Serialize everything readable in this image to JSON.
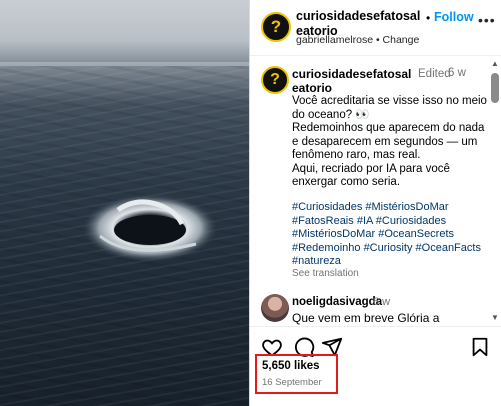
{
  "header": {
    "username": "curiosidadesefatosaleatorio",
    "separator": "•",
    "follow_label": "Follow",
    "audio": "gabriellamelrose • Change",
    "more_icon": "more-horizontal-icon"
  },
  "caption": {
    "username": "curiosidadesefatosaleatorio",
    "edited": "Edited",
    "time": "6 w",
    "lines": [
      "Você acreditaria se visse isso no meio do oceano? 👀",
      "Redemoinhos que aparecem do nada e desaparecem em segundos — um fenômeno raro, mas real.",
      "Aqui, recriado por IA para você enxergar como seria."
    ],
    "hashtags": [
      "#Curiosidades",
      "#MistériosDoMar",
      "#FatosReais",
      "#IA",
      "#Curiosidades",
      "#MistériosDoMar",
      "#OceanSecrets",
      "#Redemoinho",
      "#Curiosity",
      "#OceanFacts",
      "#natureza"
    ],
    "see_translation": "See translation"
  },
  "reply": {
    "username": "noeligdasivagda",
    "time": "6 w",
    "text": "Que vem em breve Glória a"
  },
  "actions": {
    "like_icon": "heart-icon",
    "comment_icon": "comment-icon",
    "share_icon": "send-icon",
    "save_icon": "bookmark-icon"
  },
  "likes": "5,650 likes",
  "date": "16 September",
  "colors": {
    "link": "#0095f6",
    "hashtag": "#00376b",
    "highlight": "#e41b1b",
    "avatar_ring": "#f2c200"
  }
}
